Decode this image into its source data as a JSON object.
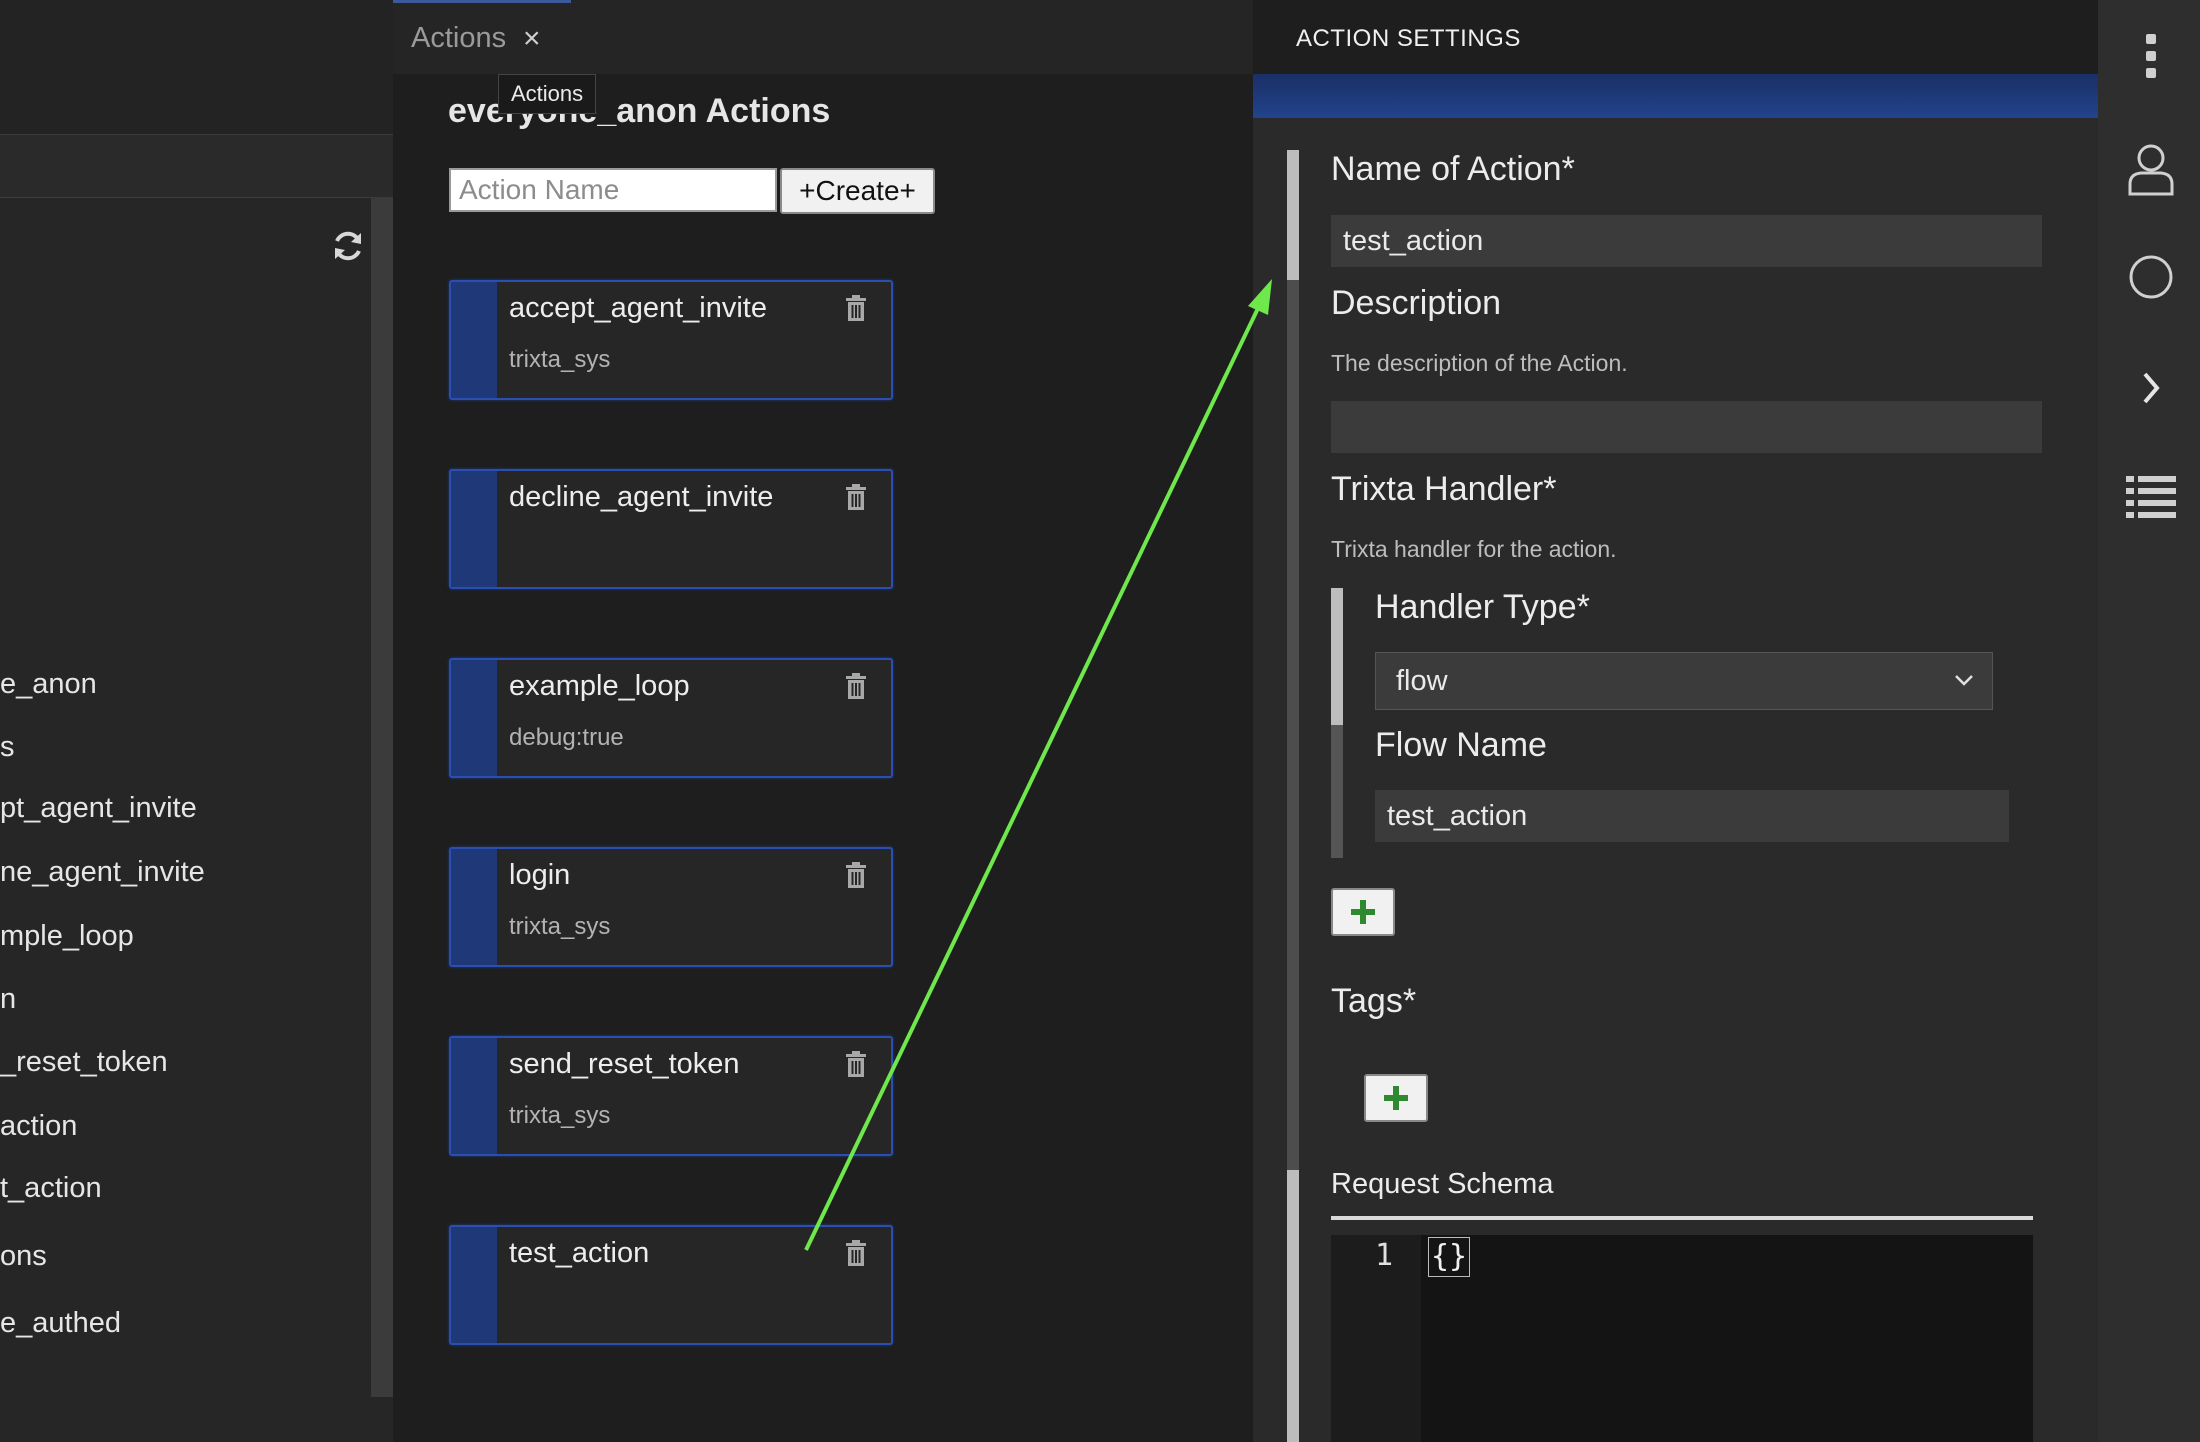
{
  "tab": {
    "label": "Actions",
    "tooltip": "Actions"
  },
  "left_tree": {
    "items": [
      "e_anon",
      "s",
      "pt_agent_invite",
      "ne_agent_invite",
      "mple_loop",
      "n",
      "_reset_token",
      "action",
      "t_action",
      "ons",
      "e_authed"
    ]
  },
  "actions_panel": {
    "title": "everyone_anon Actions",
    "name_input_placeholder": "Action Name",
    "create_label": "+Create+",
    "cards": [
      {
        "name": "accept_agent_invite",
        "subtitle": "trixta_sys"
      },
      {
        "name": "decline_agent_invite",
        "subtitle": ""
      },
      {
        "name": "example_loop",
        "subtitle": "debug:true"
      },
      {
        "name": "login",
        "subtitle": "trixta_sys"
      },
      {
        "name": "send_reset_token",
        "subtitle": "trixta_sys"
      },
      {
        "name": "test_action",
        "subtitle": ""
      }
    ]
  },
  "settings": {
    "title": "ACTION SETTINGS",
    "name_label": "Name of Action*",
    "name_value": "test_action",
    "description_label": "Description",
    "description_help": "The description of the Action.",
    "description_value": "",
    "handler_label": "Trixta Handler*",
    "handler_help": "Trixta handler for the action.",
    "handler_type_label": "Handler Type*",
    "handler_type_value": "flow",
    "flow_name_label": "Flow Name",
    "flow_name_value": "test_action",
    "tags_label": "Tags*",
    "request_schema_label": "Request Schema",
    "code_line_number": "1",
    "code_value": "{}"
  },
  "icons": {
    "refresh": "refresh-icon",
    "trash": "trash-icon",
    "add": "plus-icon",
    "activity": [
      "more-vertical-icon",
      "user-icon",
      "circle-icon",
      "chevron-right-icon",
      "list-icon"
    ]
  },
  "colors": {
    "accent_blue": "#2b4fb0",
    "annotation_arrow": "#6ee84a",
    "add_plus": "#2f8a2f"
  }
}
